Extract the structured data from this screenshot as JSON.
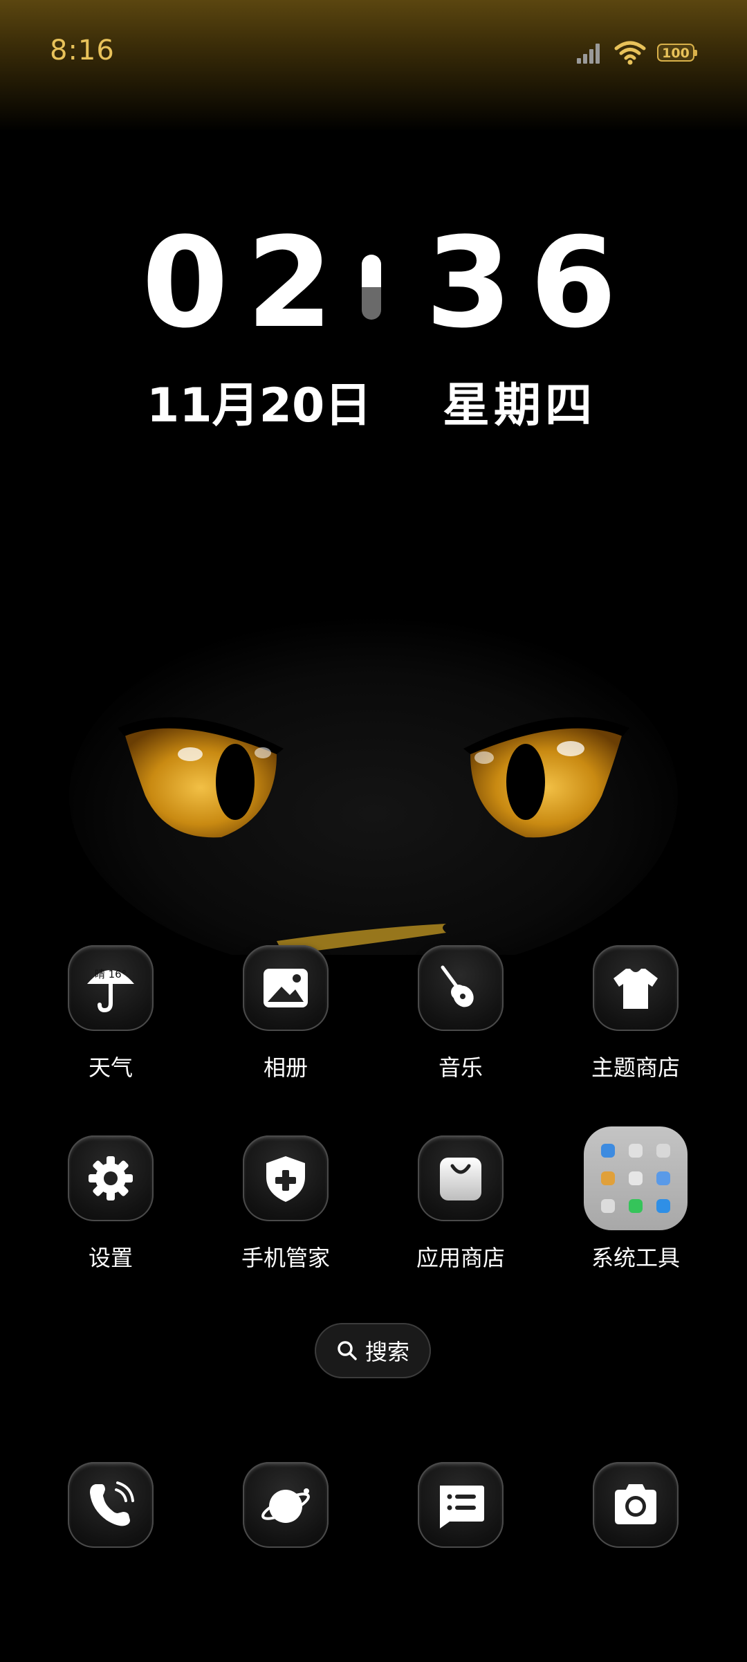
{
  "status_bar": {
    "time": "8:16",
    "battery": "100",
    "accent_color": "#e8c25a"
  },
  "clock": {
    "hours": "02",
    "minutes": "36",
    "date": "11月20日",
    "weekday": "星期四"
  },
  "apps": [
    {
      "label": "天气",
      "icon": "weather-umbrella-icon",
      "badge_text": "晴 16°"
    },
    {
      "label": "相册",
      "icon": "gallery-icon"
    },
    {
      "label": "音乐",
      "icon": "guitar-icon"
    },
    {
      "label": "主题商店",
      "icon": "tshirt-icon"
    },
    {
      "label": "设置",
      "icon": "gear-icon"
    },
    {
      "label": "手机管家",
      "icon": "shield-plus-icon"
    },
    {
      "label": "应用商店",
      "icon": "shopping-bag-icon"
    },
    {
      "label": "系统工具",
      "icon": "folder-icon"
    }
  ],
  "search": {
    "label": "搜索",
    "icon": "search-icon"
  },
  "dock": [
    {
      "icon": "phone-icon"
    },
    {
      "icon": "browser-planet-icon"
    },
    {
      "icon": "messages-icon"
    },
    {
      "icon": "camera-icon"
    }
  ]
}
